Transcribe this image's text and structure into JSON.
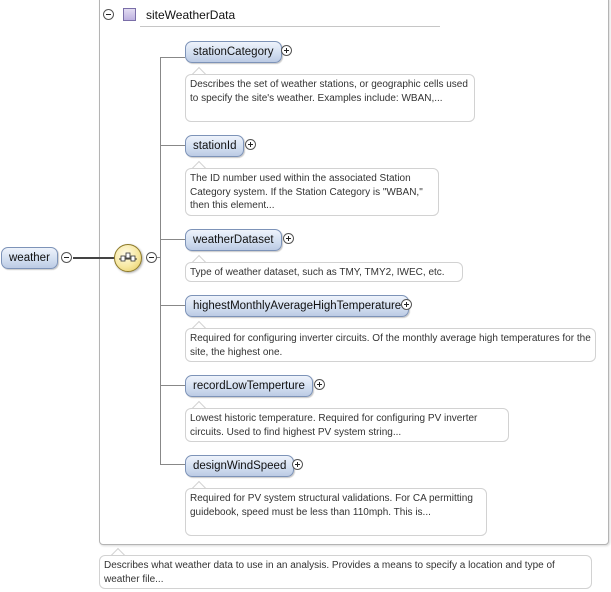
{
  "root": {
    "label": "weather",
    "documentation": "Describes what weather data to use in an analysis. Provides a means to specify a location and type of weather file..."
  },
  "complex_type": {
    "name": "siteWeatherData"
  },
  "elements": [
    {
      "name": "stationCategory",
      "documentation": "Describes the set of weather stations, or geographic cells used to specify the site's weather. Examples include: WBAN,..."
    },
    {
      "name": "stationId",
      "documentation": "The ID number used within the associated Station Category system. If the Station Category is \"WBAN,\" then this element..."
    },
    {
      "name": "weatherDataset",
      "documentation": "Type of weather dataset, such as TMY, TMY2, IWEC, etc."
    },
    {
      "name": "highestMonthlyAverageHighTemperature",
      "documentation": "Required for configuring inverter circuits. Of the monthly average high temperatures for the site, the highest one."
    },
    {
      "name": "recordLowTemperture",
      "documentation": "Lowest historic temperature. Required for configuring PV inverter circuits. Used to find highest PV system string..."
    },
    {
      "name": "designWindSpeed",
      "documentation": "Required for PV system structural validations. For CA permitting guidebook, speed must be less than 110mph. This is..."
    }
  ]
}
